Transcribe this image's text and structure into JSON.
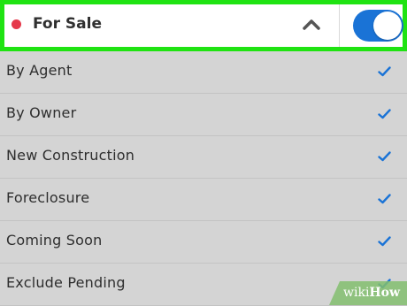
{
  "header": {
    "title": "For Sale",
    "toggle_on": true,
    "status_dot_color": "#e5394b",
    "highlight_color": "#1fe312",
    "toggle_color": "#1a73d6"
  },
  "options": [
    {
      "label": "By Agent",
      "checked": true
    },
    {
      "label": "By Owner",
      "checked": true
    },
    {
      "label": "New Construction",
      "checked": true
    },
    {
      "label": "Foreclosure",
      "checked": true
    },
    {
      "label": "Coming Soon",
      "checked": true
    },
    {
      "label": "Exclude Pending",
      "checked": true
    }
  ],
  "watermark": {
    "prefix": "wiki",
    "suffix": "How"
  }
}
